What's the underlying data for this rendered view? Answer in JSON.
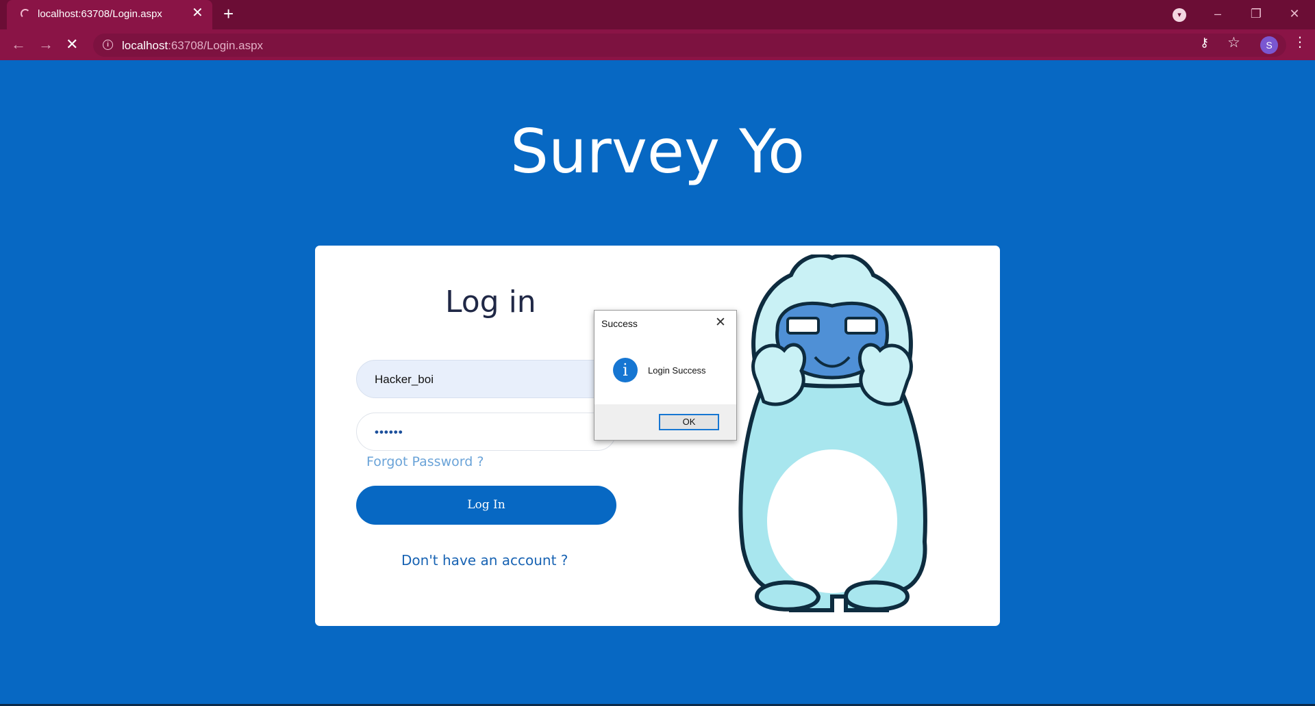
{
  "browser": {
    "tab_title": "localhost:63708/Login.aspx",
    "url_host": "localhost",
    "url_path": ":63708/Login.aspx",
    "avatar_letter": "S"
  },
  "page": {
    "brand_title": "Survey Yo",
    "login_heading": "Log in",
    "username_value": "Hacker_boi",
    "password_value": "••••••",
    "forgot_link": "Forgot Password ?",
    "login_button": "Log In",
    "signup_link": "Don't have an account ?"
  },
  "dialog": {
    "title": "Success",
    "message": "Login Success",
    "ok_label": "OK",
    "info_glyph": "i"
  },
  "colors": {
    "page_bg": "#0768c3",
    "chrome_dark": "#6b0d35",
    "chrome_toolbar": "#8a1446"
  },
  "icons": [
    "loading-spinner-icon",
    "close-icon",
    "plus-icon",
    "back-icon",
    "forward-icon",
    "stop-icon",
    "info-icon",
    "key-icon",
    "star-icon",
    "menu-icon",
    "yeti-mascot"
  ]
}
